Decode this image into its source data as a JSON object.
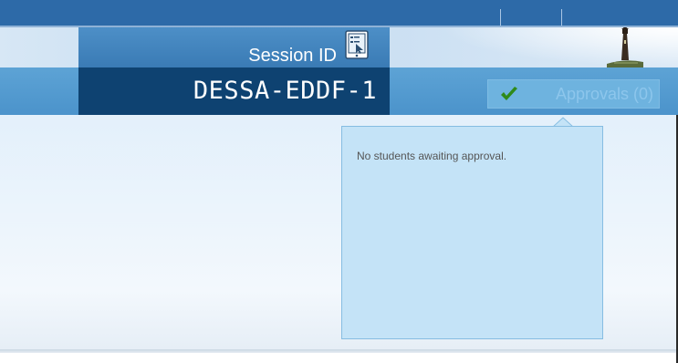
{
  "session": {
    "label": "Session ID",
    "value": "DESSA-EDDF-1",
    "icon": "tablet-pointer-icon"
  },
  "approvals": {
    "label": "Approvals (0)",
    "icon": "checkmark-icon",
    "icon_color": "#2f8a1a"
  },
  "popup": {
    "message": "No students awaiting approval."
  },
  "colors": {
    "top_bar": "#2d6aa8",
    "session_label_bg": "#3a7bb5",
    "session_value_bg": "#0e4271",
    "blue_bar": "#4b93cb",
    "popup_bg": "#c4e3f7"
  }
}
